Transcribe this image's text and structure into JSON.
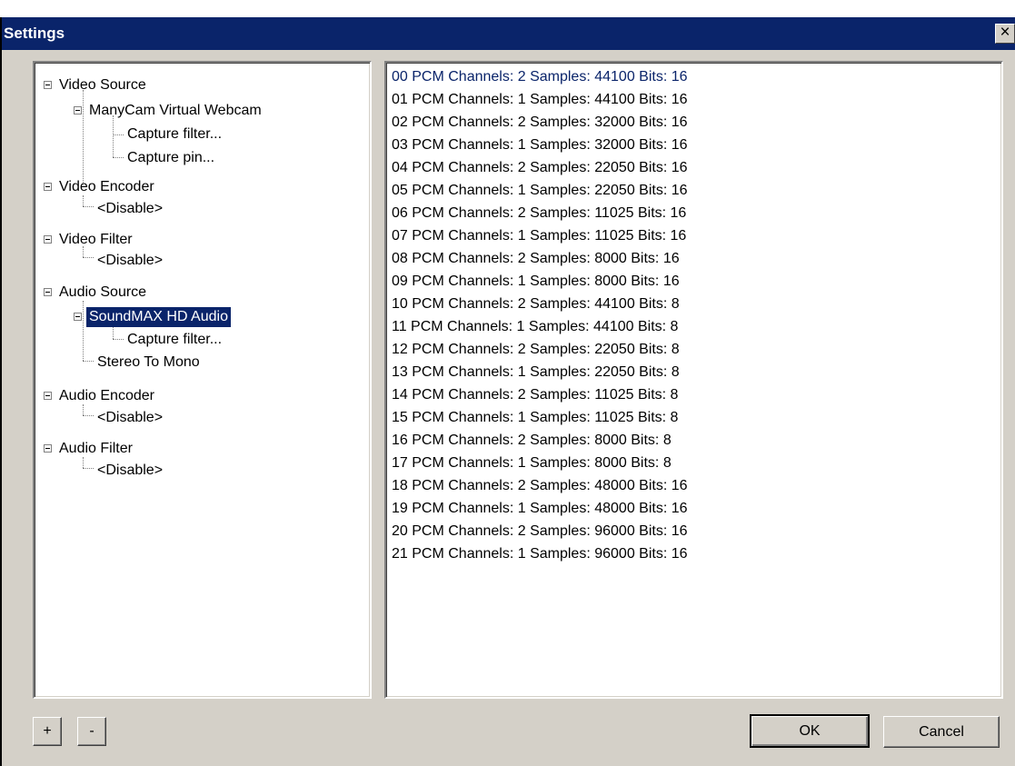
{
  "window": {
    "title": "Settings",
    "close_label": "×"
  },
  "tree": {
    "video_source": "Video Source",
    "webcam": "ManyCam Virtual Webcam",
    "webcam_capture_filter": "Capture filter...",
    "webcam_capture_pin": "Capture pin...",
    "video_encoder": "Video Encoder",
    "video_encoder_disable": "<Disable>",
    "video_filter": "Video Filter",
    "video_filter_disable": "<Disable>",
    "audio_source": "Audio Source",
    "soundmax": "SoundMAX HD Audio",
    "soundmax_capture_filter": "Capture filter...",
    "stereo_to_mono": "Stereo To Mono",
    "audio_encoder": "Audio Encoder",
    "audio_encoder_disable": "<Disable>",
    "audio_filter": "Audio Filter",
    "audio_filter_disable": "<Disable>"
  },
  "formats": [
    "00 PCM Channels: 2 Samples: 44100 Bits: 16",
    "01 PCM Channels: 1 Samples: 44100 Bits: 16",
    "02 PCM Channels: 2 Samples: 32000 Bits: 16",
    "03 PCM Channels: 1 Samples: 32000 Bits: 16",
    "04 PCM Channels: 2 Samples: 22050 Bits: 16",
    "05 PCM Channels: 1 Samples: 22050 Bits: 16",
    "06 PCM Channels: 2 Samples: 11025 Bits: 16",
    "07 PCM Channels: 1 Samples: 11025 Bits: 16",
    "08 PCM Channels: 2 Samples: 8000 Bits: 16",
    "09 PCM Channels: 1 Samples: 8000 Bits: 16",
    "10 PCM Channels: 2 Samples: 44100 Bits: 8",
    "11 PCM Channels: 1 Samples: 44100 Bits: 8",
    "12 PCM Channels: 2 Samples: 22050 Bits: 8",
    "13 PCM Channels: 1 Samples: 22050 Bits: 8",
    "14 PCM Channels: 2 Samples: 11025 Bits: 8",
    "15 PCM Channels: 1 Samples: 11025 Bits: 8",
    "16 PCM Channels: 2 Samples: 8000 Bits: 8",
    "17 PCM Channels: 1 Samples: 8000 Bits: 8",
    "18 PCM Channels: 2 Samples: 48000 Bits: 16",
    "19 PCM Channels: 1 Samples: 48000 Bits: 16",
    "20 PCM Channels: 2 Samples: 96000 Bits: 16",
    "21 PCM Channels: 1 Samples: 96000 Bits: 16"
  ],
  "buttons": {
    "add": "+",
    "remove": "-",
    "ok": "OK",
    "cancel": "Cancel"
  }
}
